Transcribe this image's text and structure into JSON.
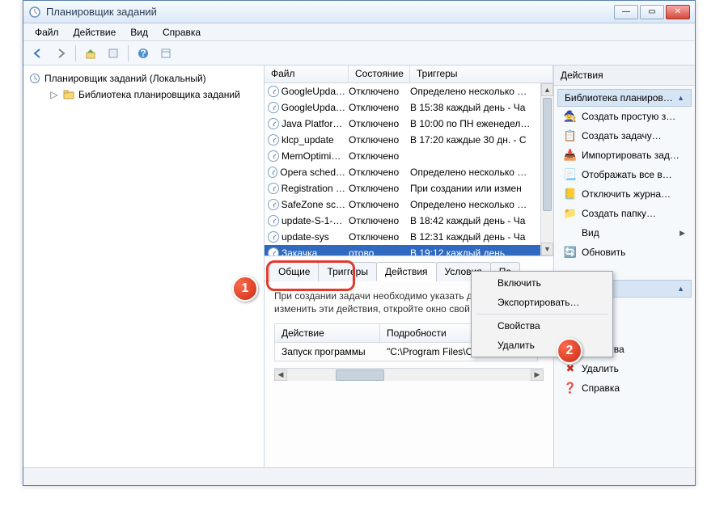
{
  "window": {
    "title": "Планировщик заданий"
  },
  "menu": {
    "file": "Файл",
    "action": "Действие",
    "view": "Вид",
    "help": "Справка"
  },
  "tree": {
    "root": "Планировщик заданий (Локальный)",
    "library": "Библиотека планировщика заданий"
  },
  "columns": {
    "file": "Файл",
    "state": "Состояние",
    "triggers": "Триггеры"
  },
  "tasks": [
    {
      "name": "GoogleUpda…",
      "state": "Отключено",
      "trigger": "Определено несколько …"
    },
    {
      "name": "GoogleUpda…",
      "state": "Отключено",
      "trigger": "В 15:38 каждый день - Ча"
    },
    {
      "name": "Java Platfor…",
      "state": "Отключено",
      "trigger": "В 10:00 по ПН еженедел…"
    },
    {
      "name": "klcp_update",
      "state": "Отключено",
      "trigger": "В 17:20 каждые 30 дн. - С"
    },
    {
      "name": "MemOptimi…",
      "state": "Отключено",
      "trigger": ""
    },
    {
      "name": "Opera sched…",
      "state": "Отключено",
      "trigger": "Определено несколько …"
    },
    {
      "name": "Registration …",
      "state": "Отключено",
      "trigger": "При создании или измен"
    },
    {
      "name": "SafeZone sc…",
      "state": "Отключено",
      "trigger": "Определено несколько …"
    },
    {
      "name": "update-S-1-…",
      "state": "Отключено",
      "trigger": "В 18:42 каждый день - Ча"
    },
    {
      "name": "update-sys",
      "state": "Отключено",
      "trigger": "В 12:31 каждый день - Ча"
    },
    {
      "name": "Закачка",
      "state": "отово",
      "trigger": "В 19:12 каждый день",
      "selected": true
    }
  ],
  "tabs": {
    "general": "Общие",
    "triggers": "Триггеры",
    "actions": "Действия",
    "conditions": "Условия",
    "settings": "Па"
  },
  "details": {
    "note": "При создании задачи необходимо указать д\nизменить эти действия, откройте окно свой",
    "col_action": "Действие",
    "col_details": "Подробности",
    "row_action": "Запуск программы",
    "row_details": "\"C:\\Program Files\\Opera\\launch"
  },
  "actions": {
    "header": "Действия",
    "sec1": "Библиотека планиров…",
    "create_basic": "Создать простую з…",
    "create_task": "Создать задачу…",
    "import": "Импортировать зад…",
    "show_all": "Отображать все в…",
    "disable_log": "Отключить журна…",
    "new_folder": "Создать папку…",
    "view": "Вид",
    "refresh": "Обновить",
    "sec2": "ент",
    "export": "орт…",
    "properties": "Свойства",
    "delete": "Удалить",
    "help": "Справка"
  },
  "context": {
    "enable": "Включить",
    "export": "Экспортировать…",
    "properties": "Свойства",
    "delete": "Удалить"
  },
  "badges": {
    "one": "1",
    "two": "2"
  }
}
